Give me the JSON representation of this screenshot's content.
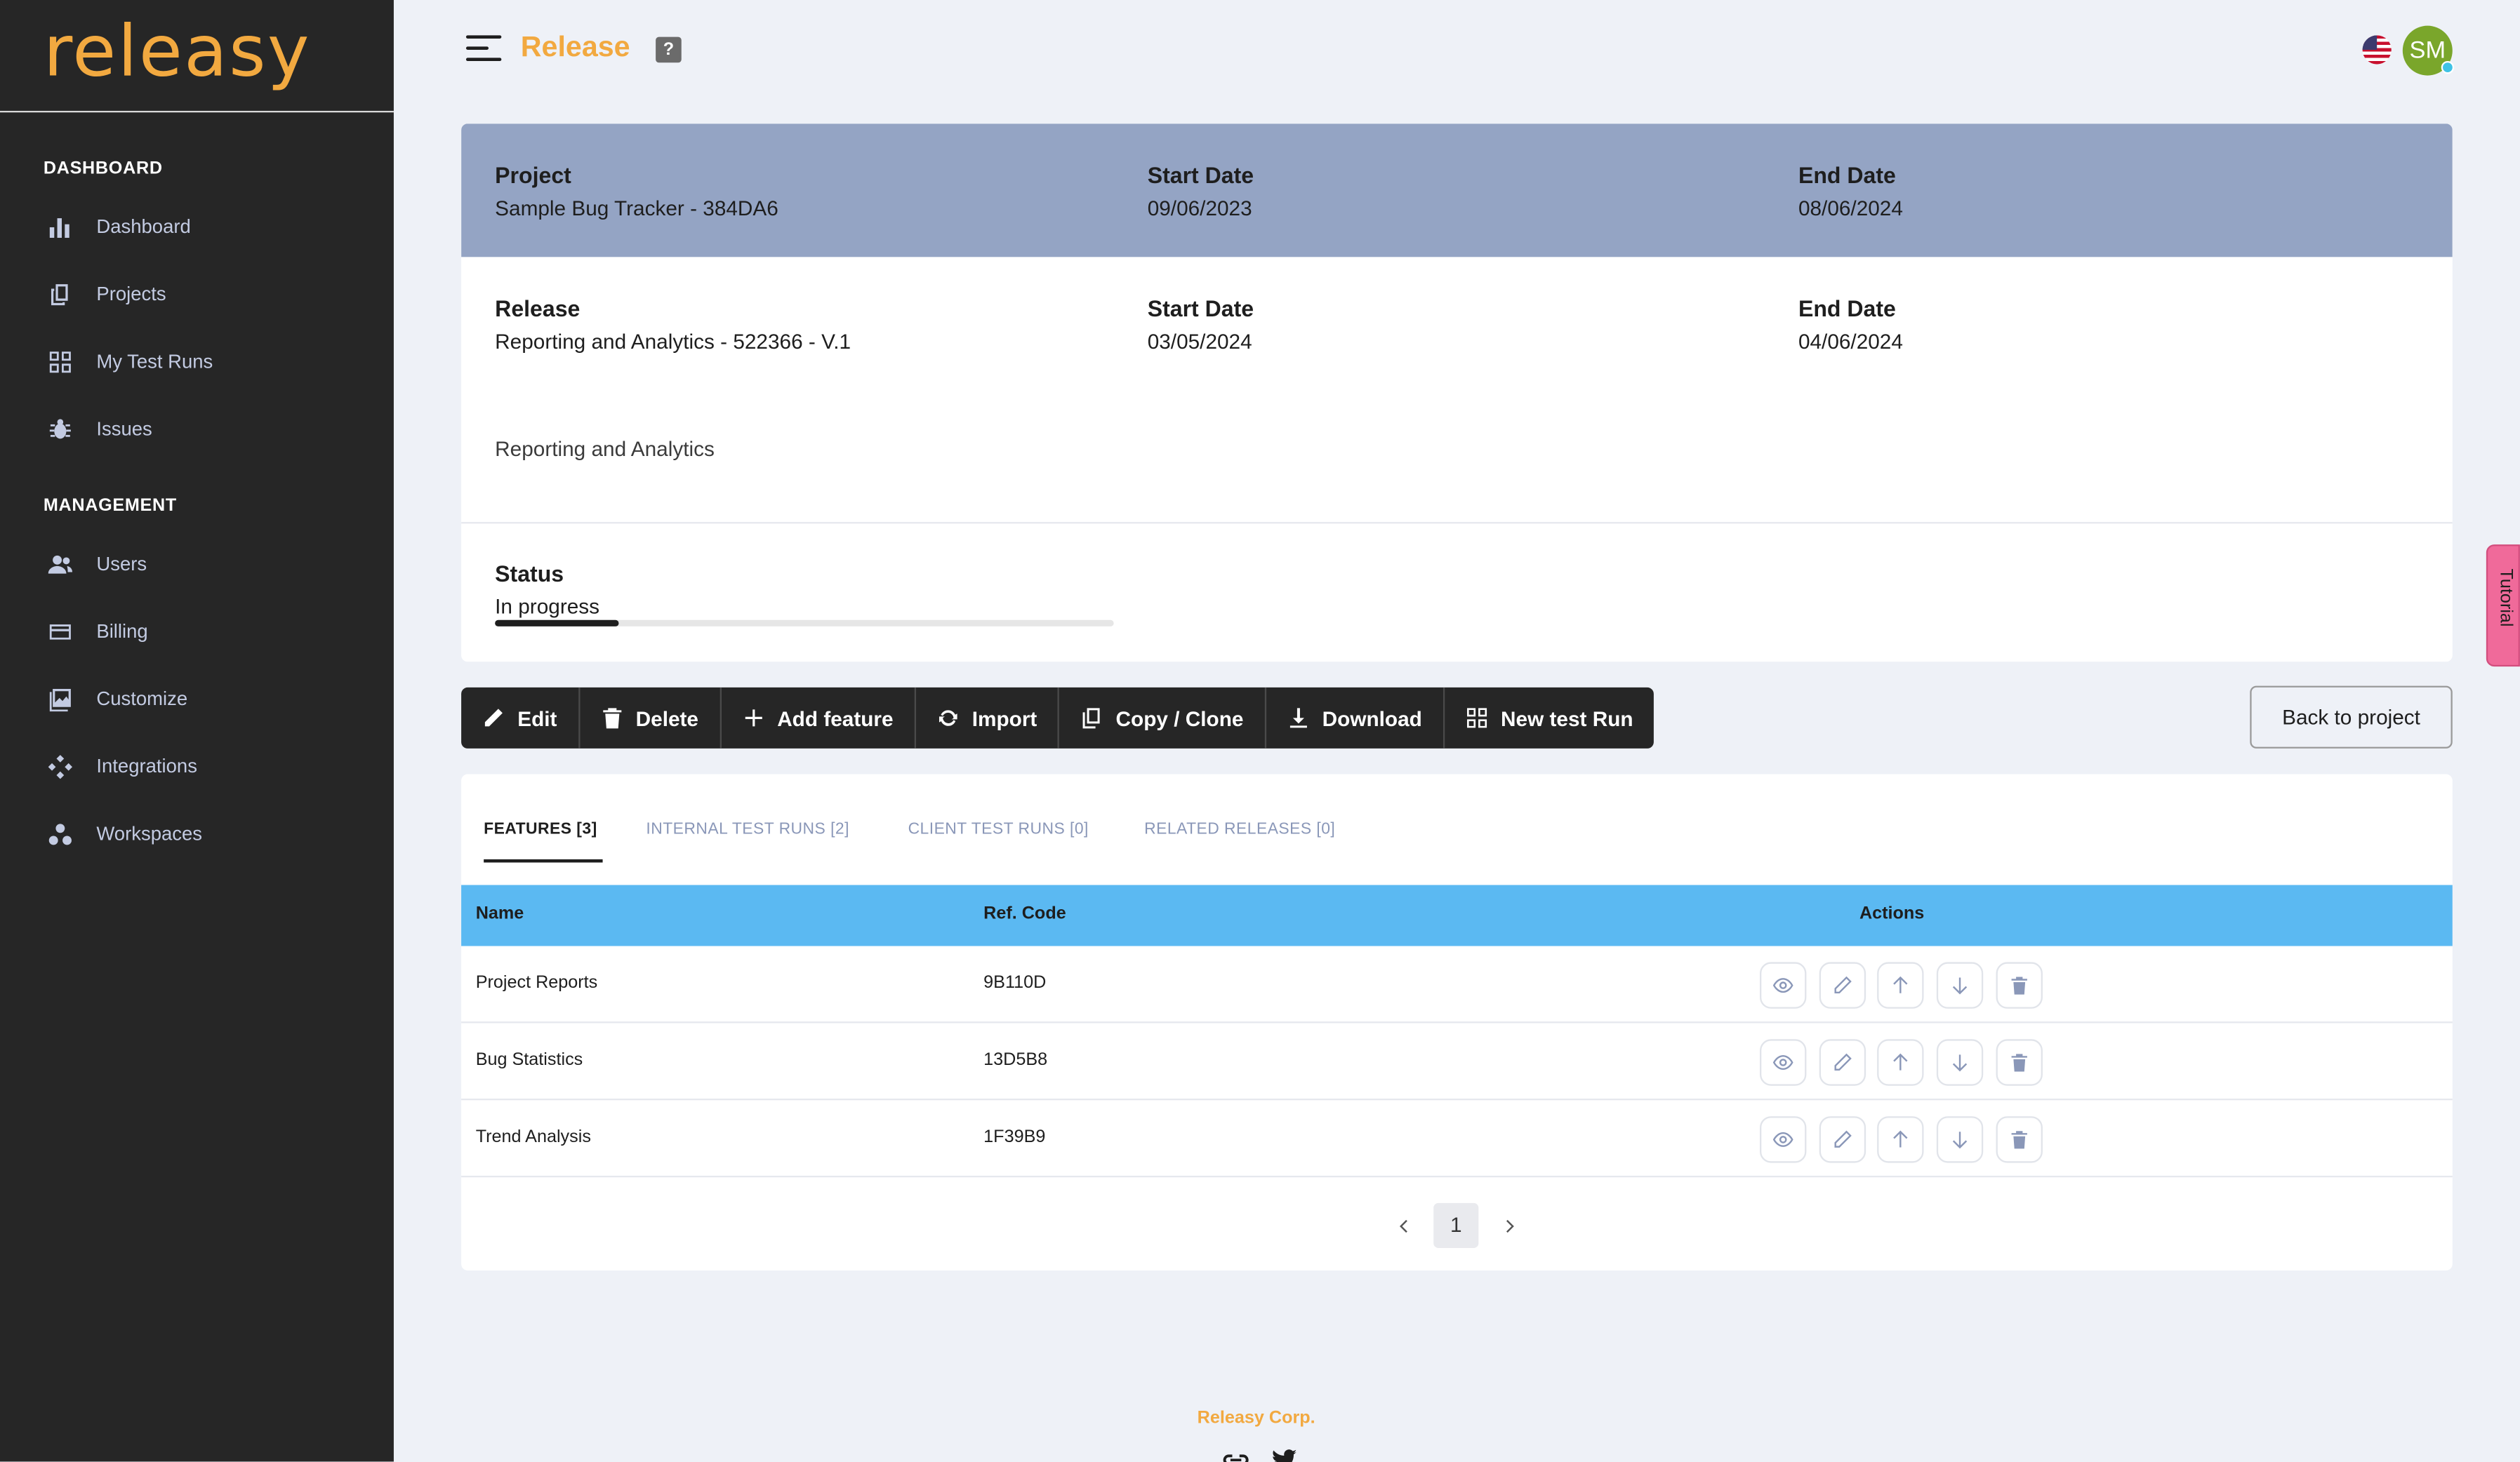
{
  "app": {
    "logo_text": "releasy"
  },
  "sidebar": {
    "sections": [
      {
        "title": "DASHBOARD"
      },
      {
        "title": "MANAGEMENT"
      }
    ],
    "items": [
      {
        "label": "Dashboard",
        "icon": "bar-chart-icon"
      },
      {
        "label": "Projects",
        "icon": "copy-icon"
      },
      {
        "label": "My Test Runs",
        "icon": "grid-icon"
      },
      {
        "label": "Issues",
        "icon": "bug-icon"
      },
      {
        "label": "Users",
        "icon": "users-icon"
      },
      {
        "label": "Billing",
        "icon": "credit-card-icon"
      },
      {
        "label": "Customize",
        "icon": "image-gallery-icon"
      },
      {
        "label": "Integrations",
        "icon": "integrations-icon"
      },
      {
        "label": "Workspaces",
        "icon": "workspaces-icon"
      }
    ]
  },
  "header": {
    "title": "Release",
    "help": "?",
    "avatar_initials": "SM"
  },
  "project": {
    "project_label": "Project",
    "project_value": "Sample Bug Tracker - 384DA6",
    "start_label": "Start Date",
    "start_value": "09/06/2023",
    "end_label": "End Date",
    "end_value": "08/06/2024"
  },
  "release": {
    "release_label": "Release",
    "release_value": "Reporting and Analytics - 522366 - V.1",
    "start_label": "Start Date",
    "start_value": "03/05/2024",
    "end_label": "End Date",
    "end_value": "04/06/2024",
    "description": "Reporting and Analytics",
    "status_label": "Status",
    "status_value": "In progress",
    "progress_fraction": 0.2
  },
  "toolbar": {
    "edit": "Edit",
    "delete": "Delete",
    "add_feature": "Add feature",
    "import": "Import",
    "copy_clone": "Copy / Clone",
    "download": "Download",
    "new_test_run": "New test Run",
    "back": "Back to project"
  },
  "tabs": [
    {
      "label": "FEATURES [3]"
    },
    {
      "label": "INTERNAL TEST RUNS [2]"
    },
    {
      "label": "CLIENT TEST RUNS [0]"
    },
    {
      "label": "RELATED RELEASES [0]"
    }
  ],
  "table": {
    "headers": {
      "name": "Name",
      "ref": "Ref. Code",
      "actions": "Actions"
    },
    "rows": [
      {
        "name": "Project Reports",
        "ref": "9B110D"
      },
      {
        "name": "Bug Statistics",
        "ref": "13D5B8"
      },
      {
        "name": "Trend Analysis",
        "ref": "1F39B9"
      }
    ]
  },
  "pagination": {
    "current": "1"
  },
  "tutorial": {
    "label": "Tutorial"
  },
  "footer": {
    "company": "Releasy Corp."
  }
}
